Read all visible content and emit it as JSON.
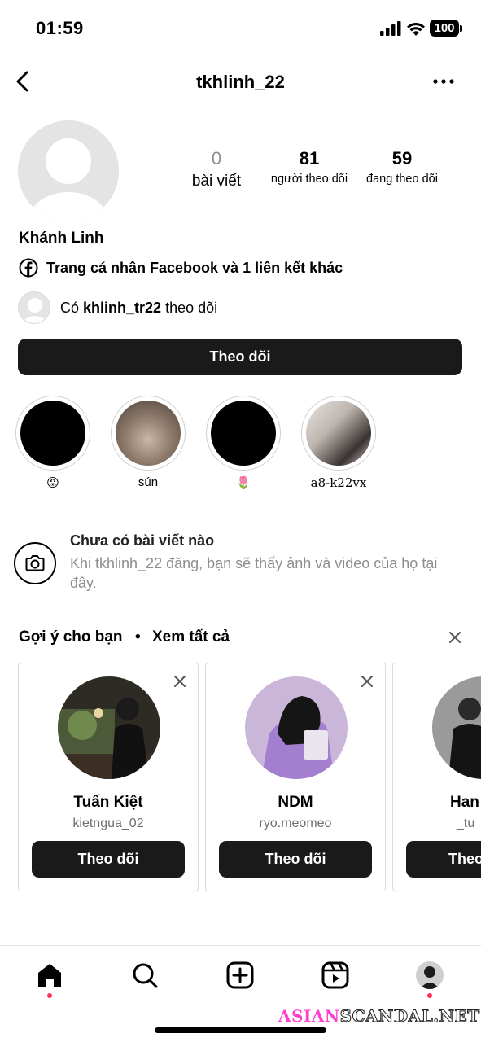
{
  "status": {
    "time": "01:59",
    "battery": "100"
  },
  "header": {
    "username": "tkhlinh_22"
  },
  "profile": {
    "display_name": "Khánh Linh",
    "stats": [
      {
        "value": "0",
        "label": "bài viết"
      },
      {
        "value": "81",
        "label": "người theo dõi"
      },
      {
        "value": "59",
        "label": "đang theo dõi"
      }
    ],
    "link_text": "Trang cá nhân Facebook và 1 liên kết khác",
    "mutual": {
      "prefix": "Có",
      "user": "khlinh_tr22",
      "suffix": "theo dõi"
    },
    "follow_label": "Theo dõi"
  },
  "highlights": [
    {
      "label": "😡"
    },
    {
      "label": "sún"
    },
    {
      "label": "🌷"
    },
    {
      "label": "a8-k22vx"
    }
  ],
  "no_posts": {
    "title": "Chưa có bài viết nào",
    "description": "Khi tkhlinh_22 đăng, bạn sẽ thấy ảnh và video của họ tại đây."
  },
  "suggestions": {
    "title": "Gợi ý cho bạn",
    "separator": "•",
    "see_all": "Xem tất cả",
    "cards": [
      {
        "name": "Tuấn Kiệt",
        "username": "kietngua_02",
        "button": "Theo dõi"
      },
      {
        "name": "NDM",
        "username": "ryo.meomeo",
        "button": "Theo dõi"
      },
      {
        "name": "Han",
        "username": "_tu",
        "button": "Theo"
      }
    ]
  },
  "watermark": {
    "part1": "ASIAN",
    "part2": "SCANDAL.NET"
  },
  "colors": {
    "button_bg": "#1a1a1a",
    "notification_dot": "#ff2a55",
    "secondary_text": "#8e8e8e"
  }
}
